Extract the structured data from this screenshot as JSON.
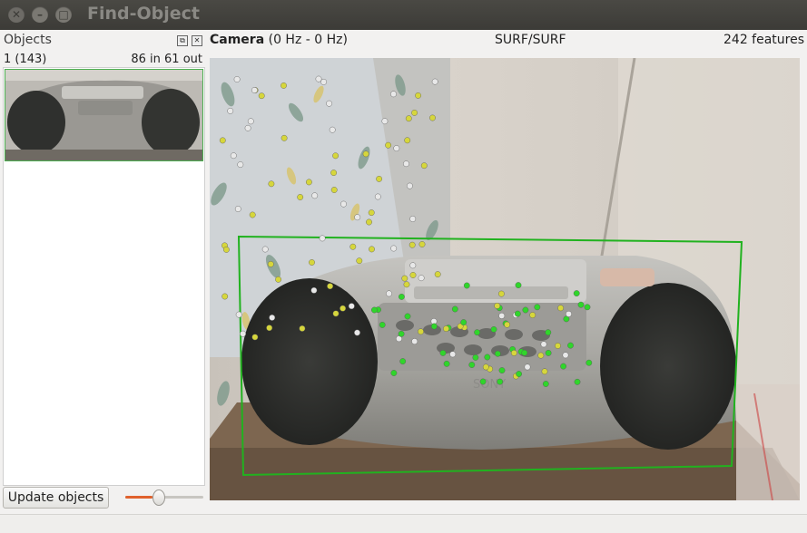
{
  "window": {
    "title": "Find-Object",
    "controls": [
      "close-icon",
      "minimize-icon",
      "maximize-icon"
    ]
  },
  "objects_panel": {
    "title": "Objects",
    "object": {
      "id_label": "1 (143)",
      "match_label": "86 in 61 out"
    },
    "update_button_label": "Update objects",
    "slider_value": 0.4
  },
  "camera_panel": {
    "title": "Camera",
    "rate": "(0 Hz - 0 Hz)",
    "detector": "SURF/SURF",
    "feature_count": "242 features"
  },
  "colors": {
    "match_box": "#21b21f",
    "inlier": "#30d52b",
    "feature": "#d6d63c",
    "feature_white": "#e8e8e8"
  }
}
